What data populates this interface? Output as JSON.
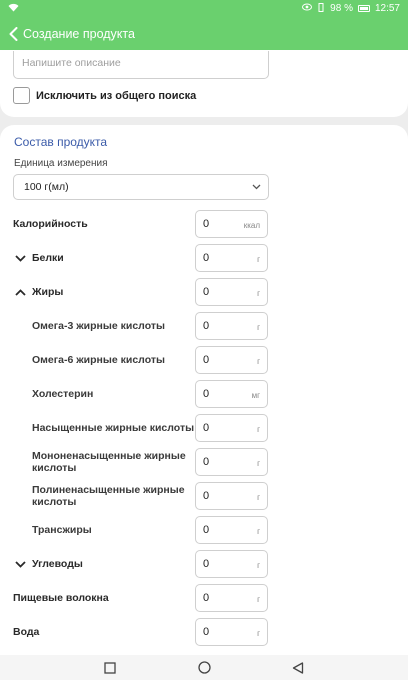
{
  "status_bar": {
    "battery": "98 %",
    "time": "12:57"
  },
  "app_bar": {
    "title": "Создание продукта"
  },
  "description": {
    "placeholder": "Напишите описание"
  },
  "exclude_search": {
    "label": "Исключить из общего поиска",
    "checked": false
  },
  "composition": {
    "title": "Состав продукта",
    "unit_label": "Единица измерения",
    "unit_value": "100 г(мл)",
    "rows": [
      {
        "label": "Калорийность",
        "value": "0",
        "unit": "ккал",
        "chevron": "none"
      },
      {
        "label": "Белки",
        "value": "0",
        "unit": "г",
        "chevron": "down"
      },
      {
        "label": "Жиры",
        "value": "0",
        "unit": "г",
        "chevron": "up"
      },
      {
        "label": "Омега-3 жирные кислоты",
        "value": "0",
        "unit": "г",
        "chevron": "sub"
      },
      {
        "label": "Омега-6 жирные кислоты",
        "value": "0",
        "unit": "г",
        "chevron": "sub"
      },
      {
        "label": "Холестерин",
        "value": "0",
        "unit": "мг",
        "chevron": "sub"
      },
      {
        "label": "Насыщенные жирные кислоты",
        "value": "0",
        "unit": "г",
        "chevron": "sub"
      },
      {
        "label": "Мононенасыщенные жирные кислоты",
        "value": "0",
        "unit": "г",
        "chevron": "sub"
      },
      {
        "label": "Полиненасыщенные жирные кислоты",
        "value": "0",
        "unit": "г",
        "chevron": "sub"
      },
      {
        "label": "Трансжиры",
        "value": "0",
        "unit": "г",
        "chevron": "sub"
      },
      {
        "label": "Углеводы",
        "value": "0",
        "unit": "г",
        "chevron": "down"
      },
      {
        "label": "Пищевые волокна",
        "value": "0",
        "unit": "г",
        "chevron": "none"
      },
      {
        "label": "Вода",
        "value": "0",
        "unit": "г",
        "chevron": "none"
      }
    ]
  },
  "colors": {
    "accent_green": "#6ad06e",
    "section_blue": "#3b5ba9"
  }
}
